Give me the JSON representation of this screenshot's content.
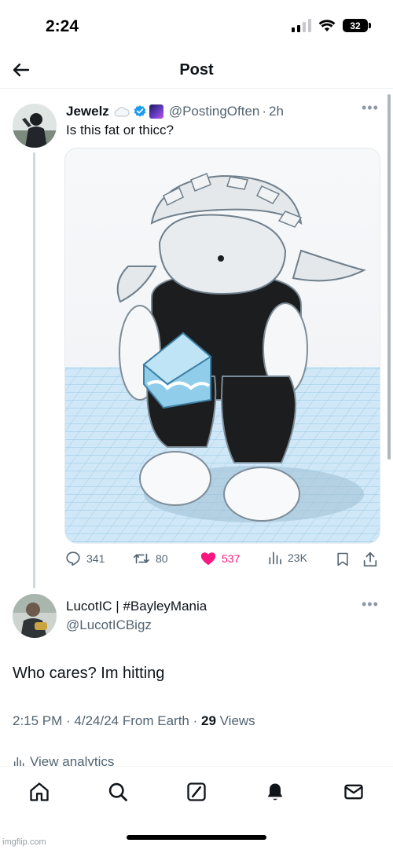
{
  "status_bar": {
    "time": "2:24",
    "battery": "32"
  },
  "header": {
    "title": "Post"
  },
  "tweet": {
    "display_name": "Jewelz",
    "handle": "@PostingOften",
    "separator": "·",
    "time_ago": "2h",
    "text": "Is this fat or thicc?",
    "stats": {
      "replies": "341",
      "reposts": "80",
      "likes": "537",
      "views": "23K"
    },
    "like_color": "#f91880",
    "verified_color": "#1d9bf0"
  },
  "reply": {
    "display_name": "LucotIC | #BayleyMania",
    "handle": "@LucotICBigz",
    "text": "Who cares? Im hitting",
    "meta_prefix": "2:15 PM · 4/24/24 From Earth · ",
    "views_count": "29",
    "views_label": " Views",
    "analytics": "View analytics"
  },
  "nav": {
    "icons": [
      "home-icon",
      "search-icon",
      "grok-icon",
      "notifications-icon",
      "messages-icon"
    ]
  },
  "watermark": "imgflip.com"
}
